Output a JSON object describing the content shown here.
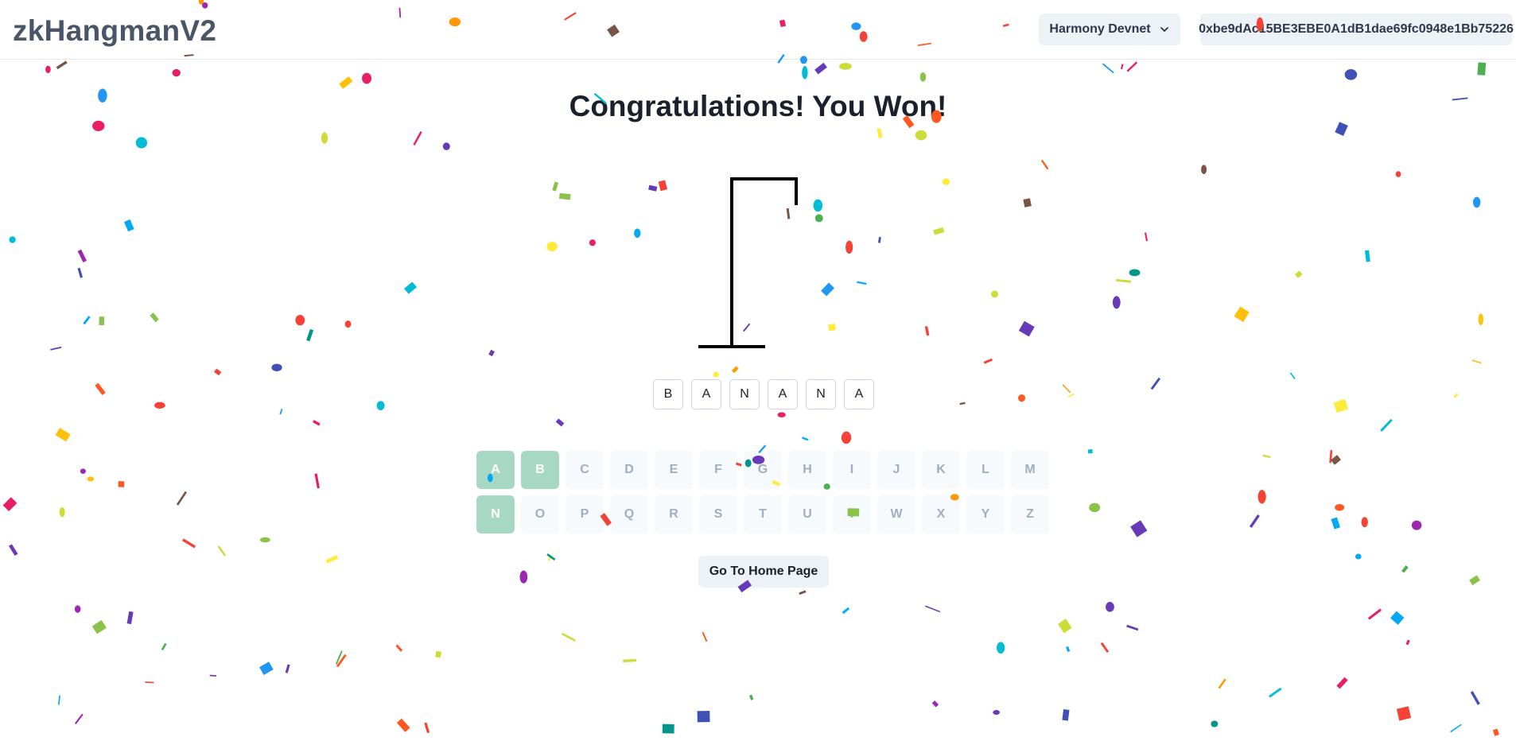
{
  "header": {
    "logo": "zkHangmanV2",
    "network": "Harmony Devnet",
    "address": "0xbe9dAc15BE3EBE0A1dB1dae69fc0948e1Bb75226"
  },
  "game": {
    "status_message": "Congratulations! You Won!",
    "word_letters": [
      "B",
      "A",
      "N",
      "A",
      "N",
      "A"
    ],
    "keyboard_rows": [
      [
        "A",
        "B",
        "C",
        "D",
        "E",
        "F",
        "G",
        "H",
        "I",
        "J",
        "K",
        "L",
        "M"
      ],
      [
        "N",
        "O",
        "P",
        "Q",
        "R",
        "S",
        "T",
        "U",
        "V",
        "W",
        "X",
        "Y",
        "Z"
      ]
    ],
    "guessed_letters": [
      "A",
      "B",
      "N"
    ],
    "home_button": "Go To Home Page"
  },
  "colors": {
    "used_key": "#a7d8c4",
    "unused_key_bg": "#f7fafc",
    "unused_key_text": "#a0aec0",
    "button_bg": "#edf2f7"
  },
  "icons": {
    "network_dropdown": "chevron-down-icon"
  }
}
